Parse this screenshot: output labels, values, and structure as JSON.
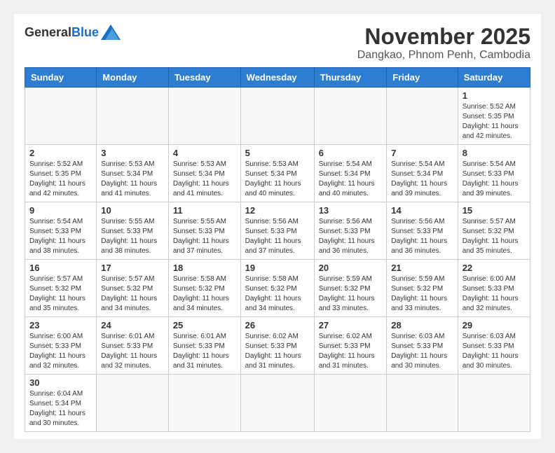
{
  "header": {
    "logo": {
      "general": "General",
      "blue": "Blue"
    },
    "title": "November 2025",
    "location": "Dangkao, Phnom Penh, Cambodia"
  },
  "weekdays": [
    "Sunday",
    "Monday",
    "Tuesday",
    "Wednesday",
    "Thursday",
    "Friday",
    "Saturday"
  ],
  "weeks": [
    [
      {
        "day": "",
        "info": ""
      },
      {
        "day": "",
        "info": ""
      },
      {
        "day": "",
        "info": ""
      },
      {
        "day": "",
        "info": ""
      },
      {
        "day": "",
        "info": ""
      },
      {
        "day": "",
        "info": ""
      },
      {
        "day": "1",
        "info": "Sunrise: 5:52 AM\nSunset: 5:35 PM\nDaylight: 11 hours and 42 minutes."
      }
    ],
    [
      {
        "day": "2",
        "info": "Sunrise: 5:52 AM\nSunset: 5:35 PM\nDaylight: 11 hours and 42 minutes."
      },
      {
        "day": "3",
        "info": "Sunrise: 5:53 AM\nSunset: 5:34 PM\nDaylight: 11 hours and 41 minutes."
      },
      {
        "day": "4",
        "info": "Sunrise: 5:53 AM\nSunset: 5:34 PM\nDaylight: 11 hours and 41 minutes."
      },
      {
        "day": "5",
        "info": "Sunrise: 5:53 AM\nSunset: 5:34 PM\nDaylight: 11 hours and 40 minutes."
      },
      {
        "day": "6",
        "info": "Sunrise: 5:54 AM\nSunset: 5:34 PM\nDaylight: 11 hours and 40 minutes."
      },
      {
        "day": "7",
        "info": "Sunrise: 5:54 AM\nSunset: 5:34 PM\nDaylight: 11 hours and 39 minutes."
      },
      {
        "day": "8",
        "info": "Sunrise: 5:54 AM\nSunset: 5:33 PM\nDaylight: 11 hours and 39 minutes."
      }
    ],
    [
      {
        "day": "9",
        "info": "Sunrise: 5:54 AM\nSunset: 5:33 PM\nDaylight: 11 hours and 38 minutes."
      },
      {
        "day": "10",
        "info": "Sunrise: 5:55 AM\nSunset: 5:33 PM\nDaylight: 11 hours and 38 minutes."
      },
      {
        "day": "11",
        "info": "Sunrise: 5:55 AM\nSunset: 5:33 PM\nDaylight: 11 hours and 37 minutes."
      },
      {
        "day": "12",
        "info": "Sunrise: 5:56 AM\nSunset: 5:33 PM\nDaylight: 11 hours and 37 minutes."
      },
      {
        "day": "13",
        "info": "Sunrise: 5:56 AM\nSunset: 5:33 PM\nDaylight: 11 hours and 36 minutes."
      },
      {
        "day": "14",
        "info": "Sunrise: 5:56 AM\nSunset: 5:33 PM\nDaylight: 11 hours and 36 minutes."
      },
      {
        "day": "15",
        "info": "Sunrise: 5:57 AM\nSunset: 5:32 PM\nDaylight: 11 hours and 35 minutes."
      }
    ],
    [
      {
        "day": "16",
        "info": "Sunrise: 5:57 AM\nSunset: 5:32 PM\nDaylight: 11 hours and 35 minutes."
      },
      {
        "day": "17",
        "info": "Sunrise: 5:57 AM\nSunset: 5:32 PM\nDaylight: 11 hours and 34 minutes."
      },
      {
        "day": "18",
        "info": "Sunrise: 5:58 AM\nSunset: 5:32 PM\nDaylight: 11 hours and 34 minutes."
      },
      {
        "day": "19",
        "info": "Sunrise: 5:58 AM\nSunset: 5:32 PM\nDaylight: 11 hours and 34 minutes."
      },
      {
        "day": "20",
        "info": "Sunrise: 5:59 AM\nSunset: 5:32 PM\nDaylight: 11 hours and 33 minutes."
      },
      {
        "day": "21",
        "info": "Sunrise: 5:59 AM\nSunset: 5:32 PM\nDaylight: 11 hours and 33 minutes."
      },
      {
        "day": "22",
        "info": "Sunrise: 6:00 AM\nSunset: 5:33 PM\nDaylight: 11 hours and 32 minutes."
      }
    ],
    [
      {
        "day": "23",
        "info": "Sunrise: 6:00 AM\nSunset: 5:33 PM\nDaylight: 11 hours and 32 minutes."
      },
      {
        "day": "24",
        "info": "Sunrise: 6:01 AM\nSunset: 5:33 PM\nDaylight: 11 hours and 32 minutes."
      },
      {
        "day": "25",
        "info": "Sunrise: 6:01 AM\nSunset: 5:33 PM\nDaylight: 11 hours and 31 minutes."
      },
      {
        "day": "26",
        "info": "Sunrise: 6:02 AM\nSunset: 5:33 PM\nDaylight: 11 hours and 31 minutes."
      },
      {
        "day": "27",
        "info": "Sunrise: 6:02 AM\nSunset: 5:33 PM\nDaylight: 11 hours and 31 minutes."
      },
      {
        "day": "28",
        "info": "Sunrise: 6:03 AM\nSunset: 5:33 PM\nDaylight: 11 hours and 30 minutes."
      },
      {
        "day": "29",
        "info": "Sunrise: 6:03 AM\nSunset: 5:33 PM\nDaylight: 11 hours and 30 minutes."
      }
    ],
    [
      {
        "day": "30",
        "info": "Sunrise: 6:04 AM\nSunset: 5:34 PM\nDaylight: 11 hours and 30 minutes."
      },
      {
        "day": "",
        "info": ""
      },
      {
        "day": "",
        "info": ""
      },
      {
        "day": "",
        "info": ""
      },
      {
        "day": "",
        "info": ""
      },
      {
        "day": "",
        "info": ""
      },
      {
        "day": "",
        "info": ""
      }
    ]
  ]
}
